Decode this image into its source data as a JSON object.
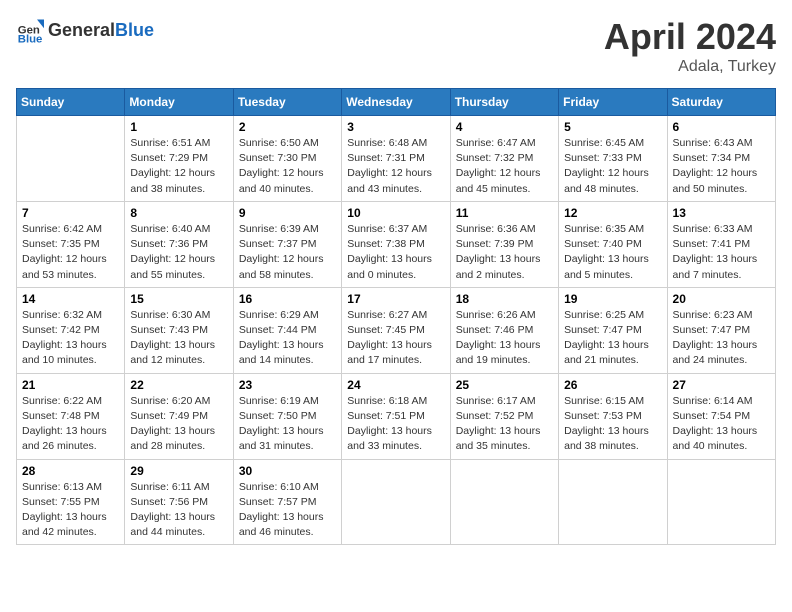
{
  "header": {
    "logo_general": "General",
    "logo_blue": "Blue",
    "title": "April 2024",
    "location": "Adala, Turkey"
  },
  "weekdays": [
    "Sunday",
    "Monday",
    "Tuesday",
    "Wednesday",
    "Thursday",
    "Friday",
    "Saturday"
  ],
  "weeks": [
    [
      {
        "day": "",
        "sunrise": "",
        "sunset": "",
        "daylight": ""
      },
      {
        "day": "1",
        "sunrise": "Sunrise: 6:51 AM",
        "sunset": "Sunset: 7:29 PM",
        "daylight": "Daylight: 12 hours and 38 minutes."
      },
      {
        "day": "2",
        "sunrise": "Sunrise: 6:50 AM",
        "sunset": "Sunset: 7:30 PM",
        "daylight": "Daylight: 12 hours and 40 minutes."
      },
      {
        "day": "3",
        "sunrise": "Sunrise: 6:48 AM",
        "sunset": "Sunset: 7:31 PM",
        "daylight": "Daylight: 12 hours and 43 minutes."
      },
      {
        "day": "4",
        "sunrise": "Sunrise: 6:47 AM",
        "sunset": "Sunset: 7:32 PM",
        "daylight": "Daylight: 12 hours and 45 minutes."
      },
      {
        "day": "5",
        "sunrise": "Sunrise: 6:45 AM",
        "sunset": "Sunset: 7:33 PM",
        "daylight": "Daylight: 12 hours and 48 minutes."
      },
      {
        "day": "6",
        "sunrise": "Sunrise: 6:43 AM",
        "sunset": "Sunset: 7:34 PM",
        "daylight": "Daylight: 12 hours and 50 minutes."
      }
    ],
    [
      {
        "day": "7",
        "sunrise": "Sunrise: 6:42 AM",
        "sunset": "Sunset: 7:35 PM",
        "daylight": "Daylight: 12 hours and 53 minutes."
      },
      {
        "day": "8",
        "sunrise": "Sunrise: 6:40 AM",
        "sunset": "Sunset: 7:36 PM",
        "daylight": "Daylight: 12 hours and 55 minutes."
      },
      {
        "day": "9",
        "sunrise": "Sunrise: 6:39 AM",
        "sunset": "Sunset: 7:37 PM",
        "daylight": "Daylight: 12 hours and 58 minutes."
      },
      {
        "day": "10",
        "sunrise": "Sunrise: 6:37 AM",
        "sunset": "Sunset: 7:38 PM",
        "daylight": "Daylight: 13 hours and 0 minutes."
      },
      {
        "day": "11",
        "sunrise": "Sunrise: 6:36 AM",
        "sunset": "Sunset: 7:39 PM",
        "daylight": "Daylight: 13 hours and 2 minutes."
      },
      {
        "day": "12",
        "sunrise": "Sunrise: 6:35 AM",
        "sunset": "Sunset: 7:40 PM",
        "daylight": "Daylight: 13 hours and 5 minutes."
      },
      {
        "day": "13",
        "sunrise": "Sunrise: 6:33 AM",
        "sunset": "Sunset: 7:41 PM",
        "daylight": "Daylight: 13 hours and 7 minutes."
      }
    ],
    [
      {
        "day": "14",
        "sunrise": "Sunrise: 6:32 AM",
        "sunset": "Sunset: 7:42 PM",
        "daylight": "Daylight: 13 hours and 10 minutes."
      },
      {
        "day": "15",
        "sunrise": "Sunrise: 6:30 AM",
        "sunset": "Sunset: 7:43 PM",
        "daylight": "Daylight: 13 hours and 12 minutes."
      },
      {
        "day": "16",
        "sunrise": "Sunrise: 6:29 AM",
        "sunset": "Sunset: 7:44 PM",
        "daylight": "Daylight: 13 hours and 14 minutes."
      },
      {
        "day": "17",
        "sunrise": "Sunrise: 6:27 AM",
        "sunset": "Sunset: 7:45 PM",
        "daylight": "Daylight: 13 hours and 17 minutes."
      },
      {
        "day": "18",
        "sunrise": "Sunrise: 6:26 AM",
        "sunset": "Sunset: 7:46 PM",
        "daylight": "Daylight: 13 hours and 19 minutes."
      },
      {
        "day": "19",
        "sunrise": "Sunrise: 6:25 AM",
        "sunset": "Sunset: 7:47 PM",
        "daylight": "Daylight: 13 hours and 21 minutes."
      },
      {
        "day": "20",
        "sunrise": "Sunrise: 6:23 AM",
        "sunset": "Sunset: 7:47 PM",
        "daylight": "Daylight: 13 hours and 24 minutes."
      }
    ],
    [
      {
        "day": "21",
        "sunrise": "Sunrise: 6:22 AM",
        "sunset": "Sunset: 7:48 PM",
        "daylight": "Daylight: 13 hours and 26 minutes."
      },
      {
        "day": "22",
        "sunrise": "Sunrise: 6:20 AM",
        "sunset": "Sunset: 7:49 PM",
        "daylight": "Daylight: 13 hours and 28 minutes."
      },
      {
        "day": "23",
        "sunrise": "Sunrise: 6:19 AM",
        "sunset": "Sunset: 7:50 PM",
        "daylight": "Daylight: 13 hours and 31 minutes."
      },
      {
        "day": "24",
        "sunrise": "Sunrise: 6:18 AM",
        "sunset": "Sunset: 7:51 PM",
        "daylight": "Daylight: 13 hours and 33 minutes."
      },
      {
        "day": "25",
        "sunrise": "Sunrise: 6:17 AM",
        "sunset": "Sunset: 7:52 PM",
        "daylight": "Daylight: 13 hours and 35 minutes."
      },
      {
        "day": "26",
        "sunrise": "Sunrise: 6:15 AM",
        "sunset": "Sunset: 7:53 PM",
        "daylight": "Daylight: 13 hours and 38 minutes."
      },
      {
        "day": "27",
        "sunrise": "Sunrise: 6:14 AM",
        "sunset": "Sunset: 7:54 PM",
        "daylight": "Daylight: 13 hours and 40 minutes."
      }
    ],
    [
      {
        "day": "28",
        "sunrise": "Sunrise: 6:13 AM",
        "sunset": "Sunset: 7:55 PM",
        "daylight": "Daylight: 13 hours and 42 minutes."
      },
      {
        "day": "29",
        "sunrise": "Sunrise: 6:11 AM",
        "sunset": "Sunset: 7:56 PM",
        "daylight": "Daylight: 13 hours and 44 minutes."
      },
      {
        "day": "30",
        "sunrise": "Sunrise: 6:10 AM",
        "sunset": "Sunset: 7:57 PM",
        "daylight": "Daylight: 13 hours and 46 minutes."
      },
      {
        "day": "",
        "sunrise": "",
        "sunset": "",
        "daylight": ""
      },
      {
        "day": "",
        "sunrise": "",
        "sunset": "",
        "daylight": ""
      },
      {
        "day": "",
        "sunrise": "",
        "sunset": "",
        "daylight": ""
      },
      {
        "day": "",
        "sunrise": "",
        "sunset": "",
        "daylight": ""
      }
    ]
  ]
}
